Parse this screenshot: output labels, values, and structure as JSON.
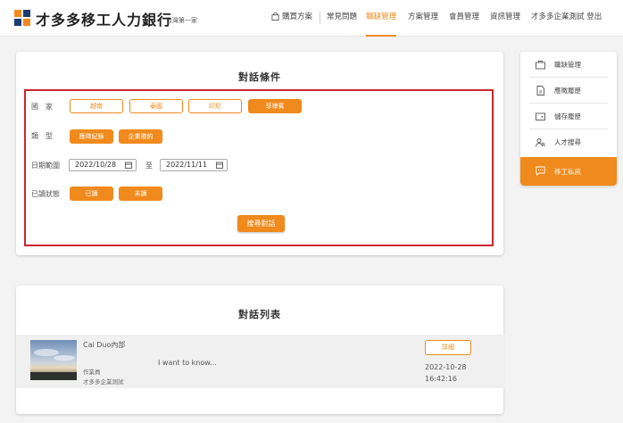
{
  "header": {
    "brand": "才多多移工人力銀行",
    "brand_sub": "台灣第一家",
    "nav": {
      "buy_plan": "購買方案",
      "faq": "常見問題",
      "recruit": "職缺管理",
      "plans": "方案管理",
      "members": "會員管理",
      "info": "資訊管理",
      "account": "才多多企業測試 登出"
    }
  },
  "filter": {
    "title": "對話條件",
    "country_label": "國　家",
    "countries": [
      "越南",
      "泰國",
      "印尼",
      "菲律賓"
    ],
    "type_label": "類　型",
    "types": [
      "應徵紀錄",
      "企業邀約"
    ],
    "date_label": "日期範圍",
    "date_from": "2022/10/28",
    "date_to_label": "至",
    "date_to": "2022/11/11",
    "read_label": "已讀狀態",
    "read_states": [
      "已讀",
      "未讀"
    ],
    "search_button": "搜尋對話"
  },
  "list": {
    "title": "對話列表",
    "items": [
      {
        "name": "Cai Duo內部",
        "message": "I want to know...",
        "role": "作業員",
        "company": "才多多企業測試",
        "detail_button": "詳細",
        "date": "2022-10-28",
        "time": "16:42:16"
      }
    ]
  },
  "sidebar": {
    "items": [
      {
        "label": "職缺管理",
        "icon": "briefcase-icon"
      },
      {
        "label": "應徵履歷",
        "icon": "resume-icon"
      },
      {
        "label": "儲存履歷",
        "icon": "wallet-icon"
      },
      {
        "label": "人才搜尋",
        "icon": "people-search-icon"
      },
      {
        "label": "移工私訊",
        "icon": "message-icon"
      }
    ]
  },
  "colors": {
    "accent": "#f08a1c",
    "highlight_border": "#c8262e",
    "background": "#f3f3f3"
  }
}
